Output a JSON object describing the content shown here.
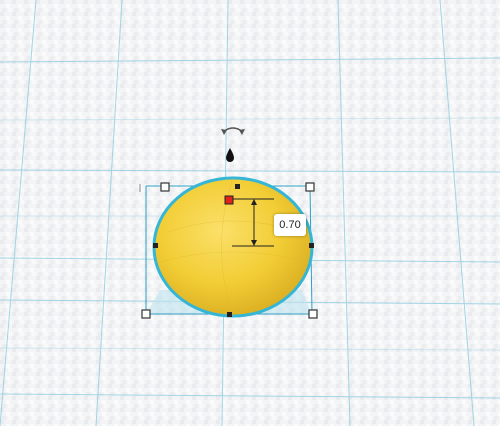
{
  "workplane": {
    "grid_color": "#8ecde0",
    "surface_color": "#f4f5f7"
  },
  "shape": {
    "type": "sphere",
    "fill_color": "#f2cf3a",
    "outline_color": "#35b6d6",
    "selected": true
  },
  "dimension": {
    "value_label": "0.70"
  },
  "tools": {
    "rotate_icon": "rotate-arrow-icon",
    "drop_icon": "drop-to-workplane-icon"
  },
  "colors": {
    "handle_fill": "#ffffff",
    "handle_stroke": "#333333",
    "active_handle": "#e0231b",
    "selection_outline": "#35b6d6"
  }
}
